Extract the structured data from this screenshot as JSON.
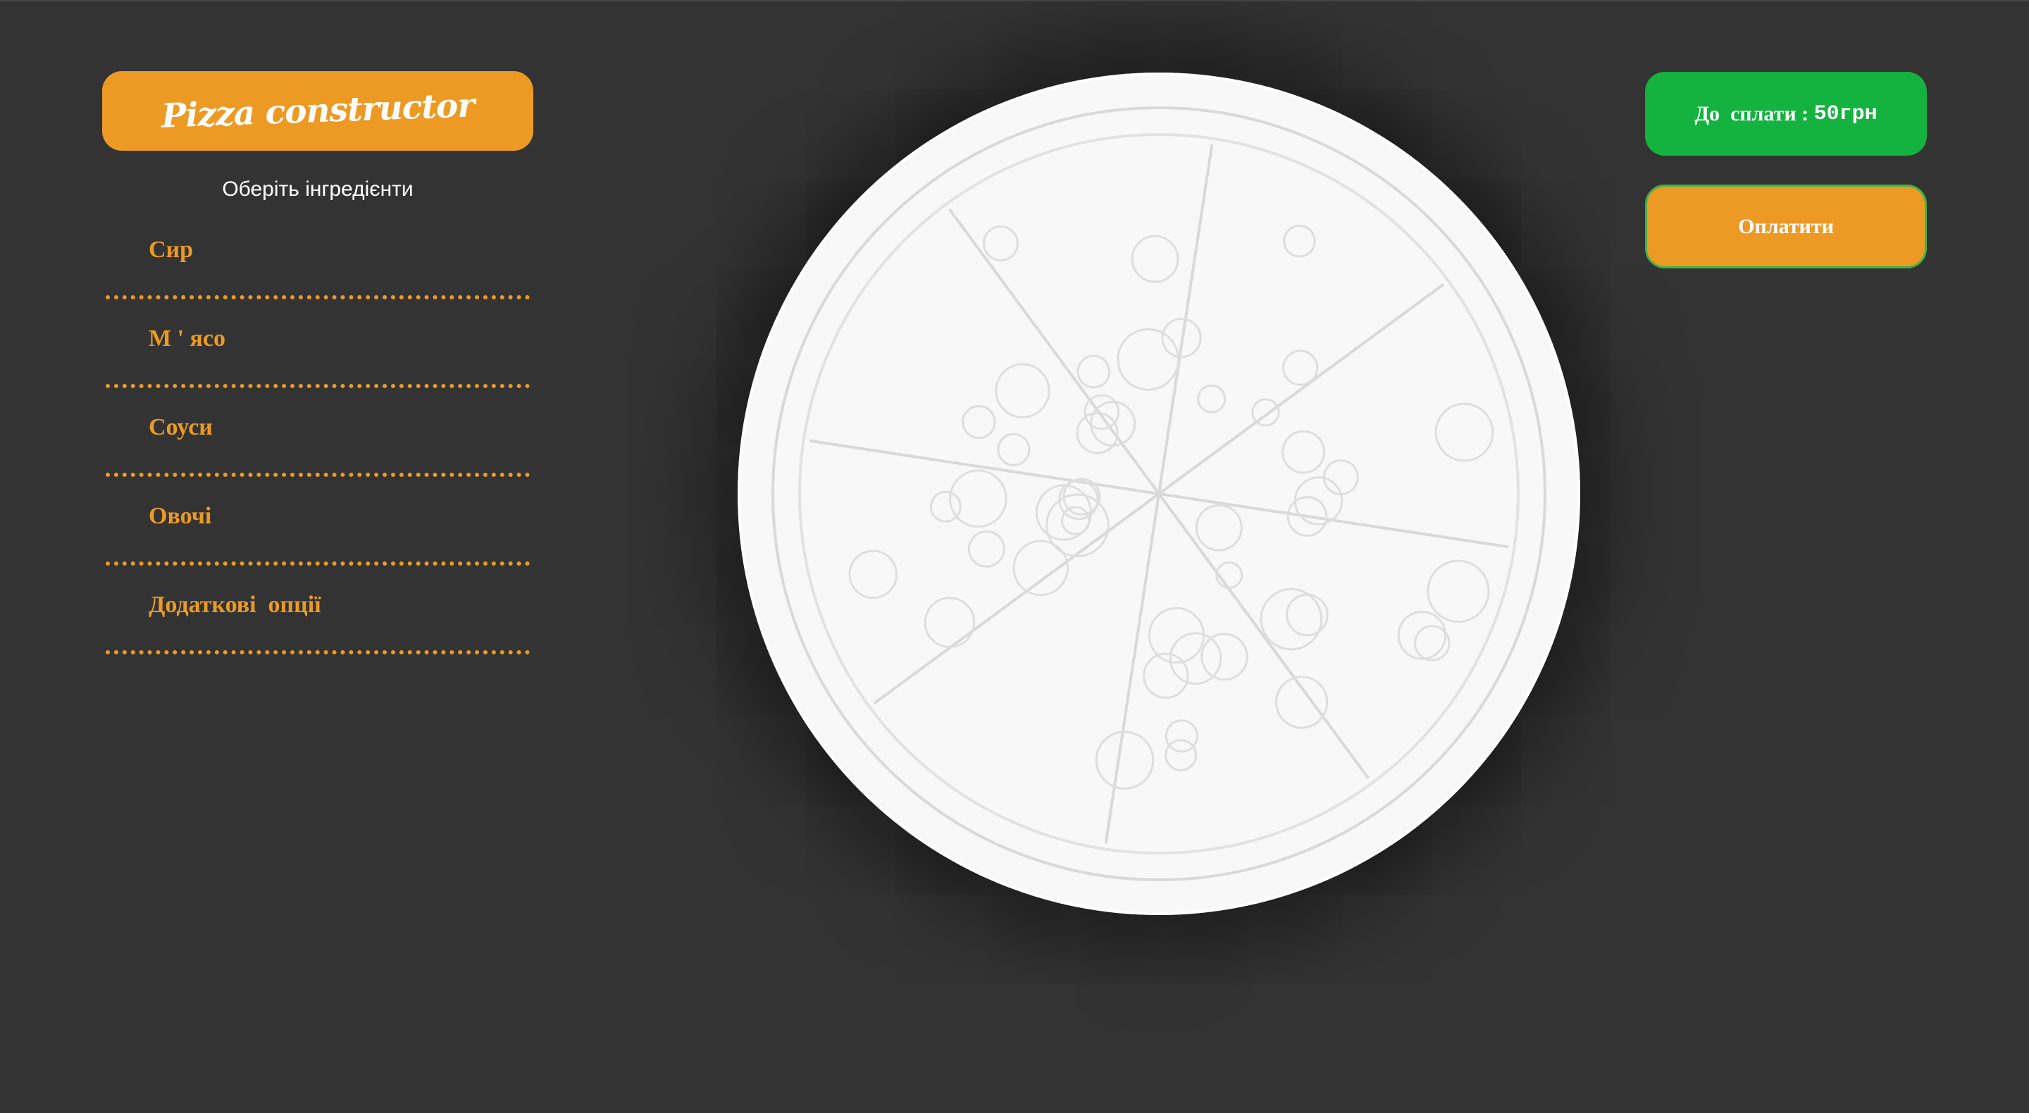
{
  "header": {
    "title": "Pizza constructor"
  },
  "sidebar": {
    "subtitle": "Оберіть інгредієнти",
    "categories": [
      {
        "label": "Сир"
      },
      {
        "label": "М ' ясо"
      },
      {
        "label": "Соуси"
      },
      {
        "label": "Овочі"
      },
      {
        "label": "Додаткові  опції"
      }
    ]
  },
  "order": {
    "total_label": "До  сплати :",
    "total_amount": "50грн",
    "pay_label": "Оплатити"
  },
  "pizza": {
    "slices": 8
  },
  "colors": {
    "background": "#333333",
    "accent": "#ec9a24",
    "total_bg": "#14b23e",
    "text": "#ffffff"
  }
}
